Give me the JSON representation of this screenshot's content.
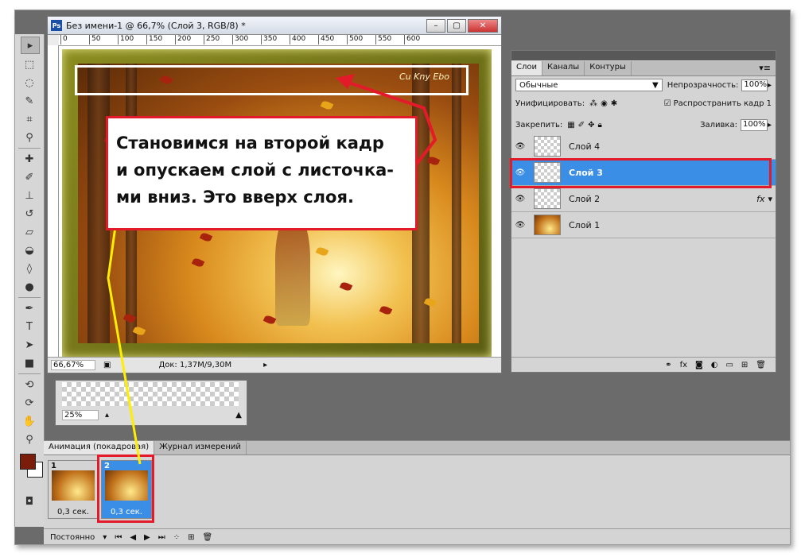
{
  "document": {
    "title": "Без имени-1 @ 66,7% (Слой 3, RGB/8) *",
    "ruler_ticks": [
      "0",
      "50",
      "100",
      "150",
      "200",
      "250",
      "300",
      "350",
      "400",
      "450",
      "500",
      "550",
      "600"
    ],
    "zoom": "66,67%",
    "doc_info": "Док: 1,37M/9,30M",
    "signature": "Cu Kny Ebo"
  },
  "navigator": {
    "zoom": "25%"
  },
  "layers_panel": {
    "tabs": [
      "Слои",
      "Каналы",
      "Контуры"
    ],
    "blend_mode": "Обычные",
    "opacity_label": "Непрозрачность:",
    "opacity_value": "100%",
    "unify_label": "Унифицировать:",
    "propagate_label": "Распространить кадр 1",
    "lock_label": "Закрепить:",
    "fill_label": "Заливка:",
    "fill_value": "100%",
    "layers": [
      {
        "name": "Слой 4",
        "selected": false
      },
      {
        "name": "Слой 3",
        "selected": true
      },
      {
        "name": "Слой 2",
        "selected": false,
        "fx": "fx"
      },
      {
        "name": "Слой 1",
        "selected": false
      }
    ]
  },
  "animation_panel": {
    "tabs": [
      "Анимация (покадровая)",
      "Журнал измерений"
    ],
    "frames": [
      {
        "number": "1",
        "delay": "0,3 сек."
      },
      {
        "number": "2",
        "delay": "0,3 сек."
      }
    ],
    "loop": "Постоянно"
  },
  "callout": {
    "lines": [
      "Становимся на второй кадр",
      "и опускаем слой с листочка-",
      "ми вниз.  Это вверх слоя."
    ]
  },
  "colors": {
    "annotation_red": "#e31a2a",
    "annotation_yellow": "#ffee00",
    "selection_blue": "#3a8ee6"
  }
}
